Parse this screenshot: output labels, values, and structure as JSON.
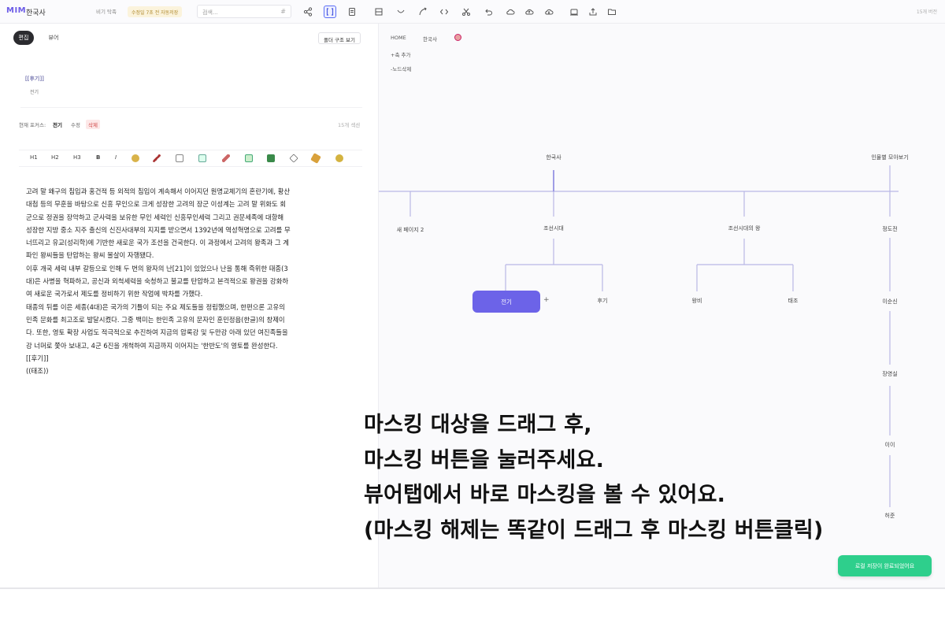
{
  "app": {
    "logo": "MIM",
    "doc_title": "한국사"
  },
  "topbar": {
    "privacy": "비기 탁족",
    "save_status": "수정일 7초 전 자동저장",
    "search_placeholder": "검색...",
    "search_hash": "#",
    "version": "15개 버전",
    "icons": [
      "share-icon",
      "brackets-icon",
      "document-icon",
      "layout-icon",
      "curve-icon",
      "arrow-curve-icon",
      "code-icon",
      "cut-icon",
      "undo-icon",
      "cloud-icon",
      "cloud-upload-icon",
      "cloud-download-icon",
      "save-icon",
      "export-icon",
      "folder-icon"
    ]
  },
  "left": {
    "mode_tabs": [
      "편집",
      "뷰어"
    ],
    "folder_view_button": "폴더 구조 보기",
    "hint": {
      "tag": "[[후기]]",
      "sub": "전기"
    },
    "focus": {
      "label": "현재 포커스:",
      "current": "전기",
      "edit": "수정",
      "delete": "삭제",
      "count": "15개 섹션"
    },
    "format_toolbar": [
      "H1",
      "H2",
      "H3",
      "B",
      "I"
    ],
    "editor_lines": [
      "고려 말 왜구의 침입과 홍건적 등 외적의 침입이 계속해서 이어지던 원명교체기의 혼란기에, 황산",
      "대첩 등의 무훈을 바탕으로 신흥 무인으로 크게 성장한 고려의 장군 이성계는 고려 말 위화도 회",
      "군으로 정권을 장악하고 군사력을 보유한 무인 세력인 신흥무인세력 그리고 권문세족에 대항해",
      "성장한 지방 중소 지주 출신의 신진사대부의 지지를 받으면서 1392년에 역성혁명으로 고려를 무",
      "너뜨리고 유교(성리학)에 기반한 새로운 국가 조선을 건국한다. 이 과정에서 고려의 왕족과 그 계",
      "파인 왕씨들을 탄압하는 왕씨 몰살이 자행됐다.",
      "이후 개국 세력 내부 갈등으로 인해 두 번의 왕자의 난[21]이 있었으나 난을 통해 즉위한 태종(3",
      "대)은 사병을 혁파하고, 공신과 외척세력을 숙청하고 불교를 탄압하고 본격적으로 왕권을 강화하",
      "여 새로운 국가로서 제도를 정비하기 위한 작업에 박차를 가했다.",
      "태종의 뒤를 이은 세종(4대)은 국가의 기틀이 되는 주요 제도들을 정립했으며, 한편으론 고유의",
      "민족 문화를 최고조로 발달시켰다. 그중 백미는 한민족 고유의 문자인 훈민정음(한글)의 창제이",
      "다. 또한, 영토 확장 사업도 적극적으로 추진하여 지금의 압록강 및 두만강 아래 있던 여진족들을",
      "강 너머로 쫓아 보내고, 4군 6진을 개척하여 지금까지 이어지는 '한반도'의 영토를 완성한다.",
      "[[후기]]",
      "((태조))"
    ]
  },
  "right": {
    "breadcrumb": [
      "HOME",
      "한국사"
    ],
    "actions": [
      "+축 추가",
      "-노드삭제"
    ],
    "tree": {
      "root": "한국사",
      "level1": [
        "새 페이지 2",
        "조선시대",
        "조선시대의 왕"
      ],
      "level2": [
        "전기",
        "후기",
        "왕비",
        "태조"
      ],
      "selected": "전기",
      "add_symbol": "+",
      "side_root": "인물별 모아보기",
      "side_chain": [
        "정도전",
        "이순신",
        "장영실",
        "이이",
        "허준"
      ]
    },
    "toast": "로컬 저장이 완료되었어요"
  },
  "overlay": {
    "lines": [
      "마스킹 대상을 드래그 후,",
      "마스킹 버튼을 눌러주세요.",
      "뷰어탭에서 바로 마스킹을 볼 수 있어요.",
      "(마스킹 해제는 똑같이 드래그 후 마스킹 버튼클릭)"
    ]
  },
  "colors": {
    "accent": "#6c63e8",
    "toast": "#2ecf8c",
    "tree_line": "#b9b7e6"
  }
}
